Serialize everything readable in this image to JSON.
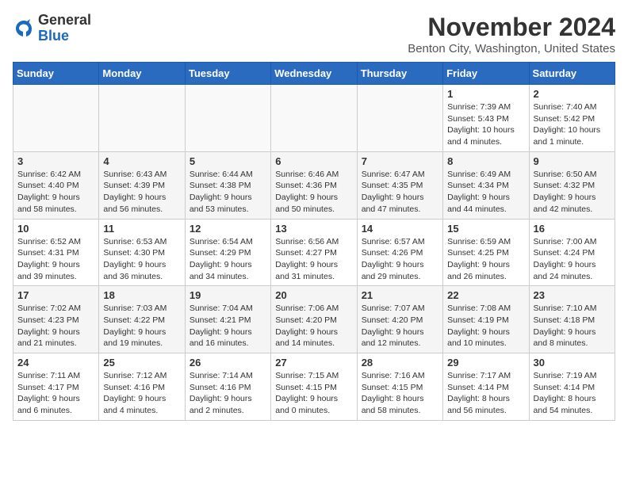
{
  "header": {
    "logo_line1": "General",
    "logo_line2": "Blue",
    "month_title": "November 2024",
    "location": "Benton City, Washington, United States"
  },
  "weekdays": [
    "Sunday",
    "Monday",
    "Tuesday",
    "Wednesday",
    "Thursday",
    "Friday",
    "Saturday"
  ],
  "weeks": [
    [
      {
        "day": "",
        "info": ""
      },
      {
        "day": "",
        "info": ""
      },
      {
        "day": "",
        "info": ""
      },
      {
        "day": "",
        "info": ""
      },
      {
        "day": "",
        "info": ""
      },
      {
        "day": "1",
        "info": "Sunrise: 7:39 AM\nSunset: 5:43 PM\nDaylight: 10 hours and 4 minutes."
      },
      {
        "day": "2",
        "info": "Sunrise: 7:40 AM\nSunset: 5:42 PM\nDaylight: 10 hours and 1 minute."
      }
    ],
    [
      {
        "day": "3",
        "info": "Sunrise: 6:42 AM\nSunset: 4:40 PM\nDaylight: 9 hours and 58 minutes."
      },
      {
        "day": "4",
        "info": "Sunrise: 6:43 AM\nSunset: 4:39 PM\nDaylight: 9 hours and 56 minutes."
      },
      {
        "day": "5",
        "info": "Sunrise: 6:44 AM\nSunset: 4:38 PM\nDaylight: 9 hours and 53 minutes."
      },
      {
        "day": "6",
        "info": "Sunrise: 6:46 AM\nSunset: 4:36 PM\nDaylight: 9 hours and 50 minutes."
      },
      {
        "day": "7",
        "info": "Sunrise: 6:47 AM\nSunset: 4:35 PM\nDaylight: 9 hours and 47 minutes."
      },
      {
        "day": "8",
        "info": "Sunrise: 6:49 AM\nSunset: 4:34 PM\nDaylight: 9 hours and 44 minutes."
      },
      {
        "day": "9",
        "info": "Sunrise: 6:50 AM\nSunset: 4:32 PM\nDaylight: 9 hours and 42 minutes."
      }
    ],
    [
      {
        "day": "10",
        "info": "Sunrise: 6:52 AM\nSunset: 4:31 PM\nDaylight: 9 hours and 39 minutes."
      },
      {
        "day": "11",
        "info": "Sunrise: 6:53 AM\nSunset: 4:30 PM\nDaylight: 9 hours and 36 minutes."
      },
      {
        "day": "12",
        "info": "Sunrise: 6:54 AM\nSunset: 4:29 PM\nDaylight: 9 hours and 34 minutes."
      },
      {
        "day": "13",
        "info": "Sunrise: 6:56 AM\nSunset: 4:27 PM\nDaylight: 9 hours and 31 minutes."
      },
      {
        "day": "14",
        "info": "Sunrise: 6:57 AM\nSunset: 4:26 PM\nDaylight: 9 hours and 29 minutes."
      },
      {
        "day": "15",
        "info": "Sunrise: 6:59 AM\nSunset: 4:25 PM\nDaylight: 9 hours and 26 minutes."
      },
      {
        "day": "16",
        "info": "Sunrise: 7:00 AM\nSunset: 4:24 PM\nDaylight: 9 hours and 24 minutes."
      }
    ],
    [
      {
        "day": "17",
        "info": "Sunrise: 7:02 AM\nSunset: 4:23 PM\nDaylight: 9 hours and 21 minutes."
      },
      {
        "day": "18",
        "info": "Sunrise: 7:03 AM\nSunset: 4:22 PM\nDaylight: 9 hours and 19 minutes."
      },
      {
        "day": "19",
        "info": "Sunrise: 7:04 AM\nSunset: 4:21 PM\nDaylight: 9 hours and 16 minutes."
      },
      {
        "day": "20",
        "info": "Sunrise: 7:06 AM\nSunset: 4:20 PM\nDaylight: 9 hours and 14 minutes."
      },
      {
        "day": "21",
        "info": "Sunrise: 7:07 AM\nSunset: 4:20 PM\nDaylight: 9 hours and 12 minutes."
      },
      {
        "day": "22",
        "info": "Sunrise: 7:08 AM\nSunset: 4:19 PM\nDaylight: 9 hours and 10 minutes."
      },
      {
        "day": "23",
        "info": "Sunrise: 7:10 AM\nSunset: 4:18 PM\nDaylight: 9 hours and 8 minutes."
      }
    ],
    [
      {
        "day": "24",
        "info": "Sunrise: 7:11 AM\nSunset: 4:17 PM\nDaylight: 9 hours and 6 minutes."
      },
      {
        "day": "25",
        "info": "Sunrise: 7:12 AM\nSunset: 4:16 PM\nDaylight: 9 hours and 4 minutes."
      },
      {
        "day": "26",
        "info": "Sunrise: 7:14 AM\nSunset: 4:16 PM\nDaylight: 9 hours and 2 minutes."
      },
      {
        "day": "27",
        "info": "Sunrise: 7:15 AM\nSunset: 4:15 PM\nDaylight: 9 hours and 0 minutes."
      },
      {
        "day": "28",
        "info": "Sunrise: 7:16 AM\nSunset: 4:15 PM\nDaylight: 8 hours and 58 minutes."
      },
      {
        "day": "29",
        "info": "Sunrise: 7:17 AM\nSunset: 4:14 PM\nDaylight: 8 hours and 56 minutes."
      },
      {
        "day": "30",
        "info": "Sunrise: 7:19 AM\nSunset: 4:14 PM\nDaylight: 8 hours and 54 minutes."
      }
    ]
  ]
}
